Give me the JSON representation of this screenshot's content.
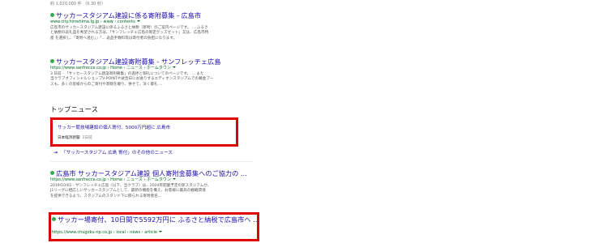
{
  "stats": "約 1,020,000 件 （0.30 秒）",
  "results": [
    {
      "title": "サッカースタジアム建設に係る寄附募集 - 広島市",
      "url": "www.city.hiroshima.lg.jp › www › contents",
      "snippet": [
        "広島市のサッカースタジアム建設に係るふるさと納税（寄附）のご案内ページです。 ... ふるさ",
        "と納税の返礼品を希望される方は、「サンフレッチェ広島の限定グッズセット」又は、広島市特",
        "産 を選択し、「寄附へ進む」」「... 返品手数料等は寄付者の負担になります。"
      ]
    },
    {
      "title": "サッカースタジアム建設寄附募集 - サンフレッチェ広島",
      "url": "https://www.sanfrecce.co.jp › Home › ニュース › ホームタウン",
      "snippet": [
        "3 日前 - 「サッカースタジアム建設寄附募集」の進捗と御礼についてのページです。 ... また",
        "当クラブオフィシャルショップV-POINTや試合日にお送りするエディオンスタジアムでの募金ブー",
        "スも、多くの皆様からのご寄付や寄贈を賜り、併せて、深く御礼 ..."
      ]
    },
    {
      "title": "広島市 サッカースタジアム建設 個人寄附金募集へのご協力の ...",
      "url": "https://www.sanfrecce.co.jp › Home › ニュース › ホームタウン",
      "snippet": [
        "2019/10/01 - サンフレッチェ広島（以下、当クラブ）は、2024年開業予定の新スタジアムが、",
        "J1リーグに相応しいサッカースタジアムとして、最新の機能を備え、お客様に最高の観戦環境",
        "を提供できるよう、スタジアムのスタンド下に飾られる寄附者名..."
      ]
    },
    {
      "title": "サッカー場寄付、10日間で5592万円に ふるさと納税で広島市へ ...",
      "url": "https://www.chugoku-np.co.jp › local › news › article",
      "snippet": []
    }
  ],
  "top_news": {
    "heading": "トップニュース",
    "title": "サッカー競技場建設の個人寄付、5000万円超に 広島市",
    "source": "日本経済新聞",
    "age": "2日前"
  },
  "more_news": "「サッカースタジアム 広島 寄付」のその他のニュース",
  "colors": {
    "link": "#1a0dab",
    "url": "#006621",
    "highlight": "#e00000"
  }
}
